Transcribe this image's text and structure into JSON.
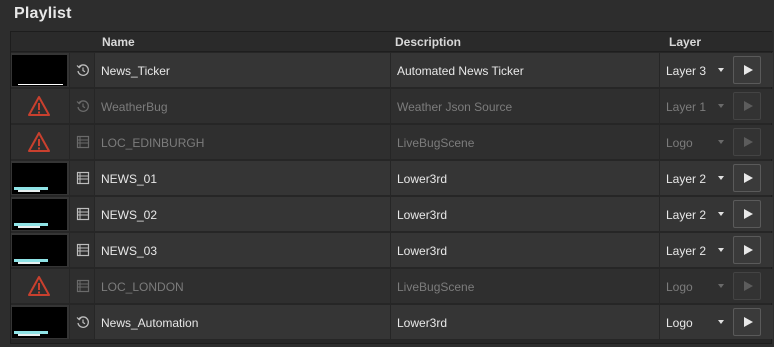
{
  "panel": {
    "title": "Playlist"
  },
  "columns": {
    "name": "Name",
    "description": "Description",
    "layer": "Layer"
  },
  "rows": [
    {
      "name": "News_Ticker",
      "description": "Automated News Ticker",
      "layer": "Layer 3",
      "status": "ok",
      "type_icon": "history-icon",
      "thumb": "ticker"
    },
    {
      "name": "WeatherBug",
      "description": "Weather Json Source",
      "layer": "Layer 1",
      "status": "error",
      "type_icon": "history-icon",
      "thumb": "warning"
    },
    {
      "name": "LOC_EDINBURGH",
      "description": "LiveBugScene",
      "layer": "Logo",
      "status": "error",
      "type_icon": "list-icon",
      "thumb": "warning"
    },
    {
      "name": "NEWS_01",
      "description": "Lower3rd",
      "layer": "Layer 2",
      "status": "ok",
      "type_icon": "list-icon",
      "thumb": "lower3rd"
    },
    {
      "name": "NEWS_02",
      "description": "Lower3rd",
      "layer": "Layer 2",
      "status": "ok",
      "type_icon": "list-icon",
      "thumb": "lower3rd"
    },
    {
      "name": "NEWS_03",
      "description": "Lower3rd",
      "layer": "Layer 2",
      "status": "ok",
      "type_icon": "list-icon",
      "thumb": "lower3rd"
    },
    {
      "name": "LOC_LONDON",
      "description": "LiveBugScene",
      "layer": "Logo",
      "status": "error",
      "type_icon": "list-icon",
      "thumb": "warning"
    },
    {
      "name": "News_Automation",
      "description": "Lower3rd",
      "layer": "Logo",
      "status": "ok",
      "type_icon": "history-icon",
      "thumb": "lower3rd"
    }
  ],
  "colors": {
    "warning": "#c9402e",
    "background": "#2d2d2d",
    "row": "#353535"
  }
}
